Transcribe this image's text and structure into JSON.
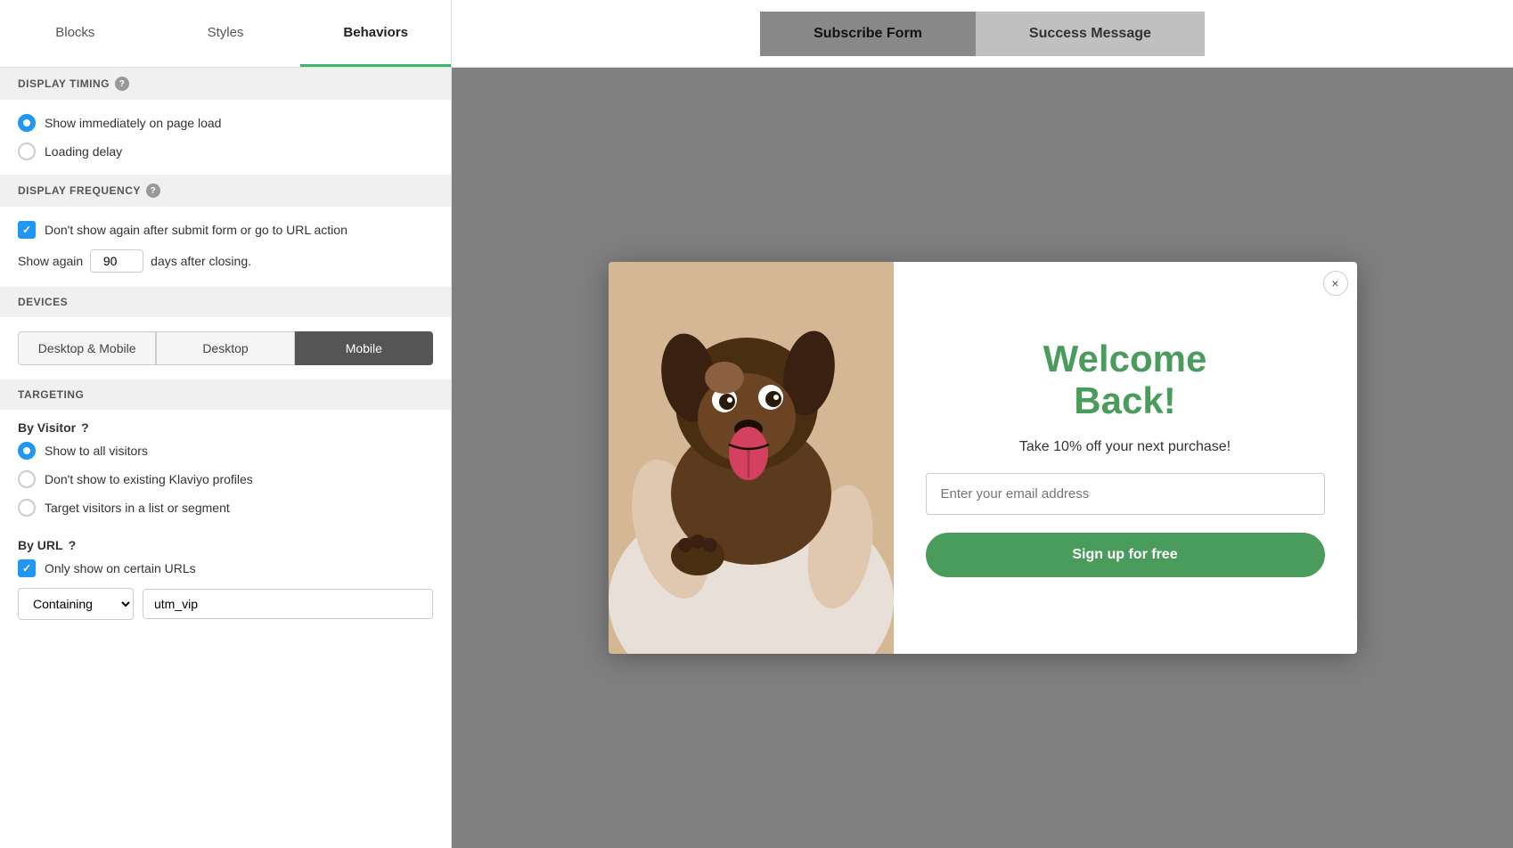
{
  "topNav": {
    "leftTabs": [
      {
        "label": "Blocks",
        "id": "blocks",
        "active": false
      },
      {
        "label": "Styles",
        "id": "styles",
        "active": false
      },
      {
        "label": "Behaviors",
        "id": "behaviors",
        "active": true
      }
    ],
    "rightTabs": [
      {
        "label": "Subscribe Form",
        "id": "subscribe-form",
        "active": true
      },
      {
        "label": "Success Message",
        "id": "success-message",
        "active": false
      }
    ]
  },
  "leftPanel": {
    "displayTiming": {
      "sectionLabel": "DISPLAY TIMING",
      "options": [
        {
          "label": "Show immediately on page load",
          "id": "show-immediately",
          "checked": true
        },
        {
          "label": "Loading delay",
          "id": "loading-delay",
          "checked": false
        }
      ]
    },
    "displayFrequency": {
      "sectionLabel": "DISPLAY FREQUENCY",
      "dontShowLabel": "Don't show again after submit form or go to URL action",
      "dontShowChecked": true,
      "showAgainLabel": "Show again",
      "daysValue": "90",
      "afterClosingLabel": "days after closing."
    },
    "devices": {
      "sectionLabel": "DEVICES",
      "buttons": [
        {
          "label": "Desktop & Mobile",
          "id": "desktop-mobile",
          "active": false
        },
        {
          "label": "Desktop",
          "id": "desktop",
          "active": false
        },
        {
          "label": "Mobile",
          "id": "mobile",
          "active": true
        }
      ]
    },
    "targeting": {
      "sectionLabel": "TARGETING",
      "byVisitor": {
        "label": "By Visitor",
        "options": [
          {
            "label": "Show to all visitors",
            "id": "all-visitors",
            "checked": true
          },
          {
            "label": "Don't show to existing Klaviyo profiles",
            "id": "no-klaviyo",
            "checked": false
          },
          {
            "label": "Target visitors in a list or segment",
            "id": "target-segment",
            "checked": false
          }
        ]
      },
      "byURL": {
        "label": "By URL",
        "onlyCertainURLs": {
          "label": "Only show on certain URLs",
          "checked": true
        },
        "filterSelect": "Containing",
        "filterValue": "utm_vip"
      }
    }
  },
  "popup": {
    "title": "Welcome\nBack!",
    "subtitle": "Take 10% off your next purchase!",
    "emailPlaceholder": "Enter your email address",
    "submitLabel": "Sign up for free",
    "closeLabel": "×",
    "accentColor": "#4a9c5d"
  }
}
